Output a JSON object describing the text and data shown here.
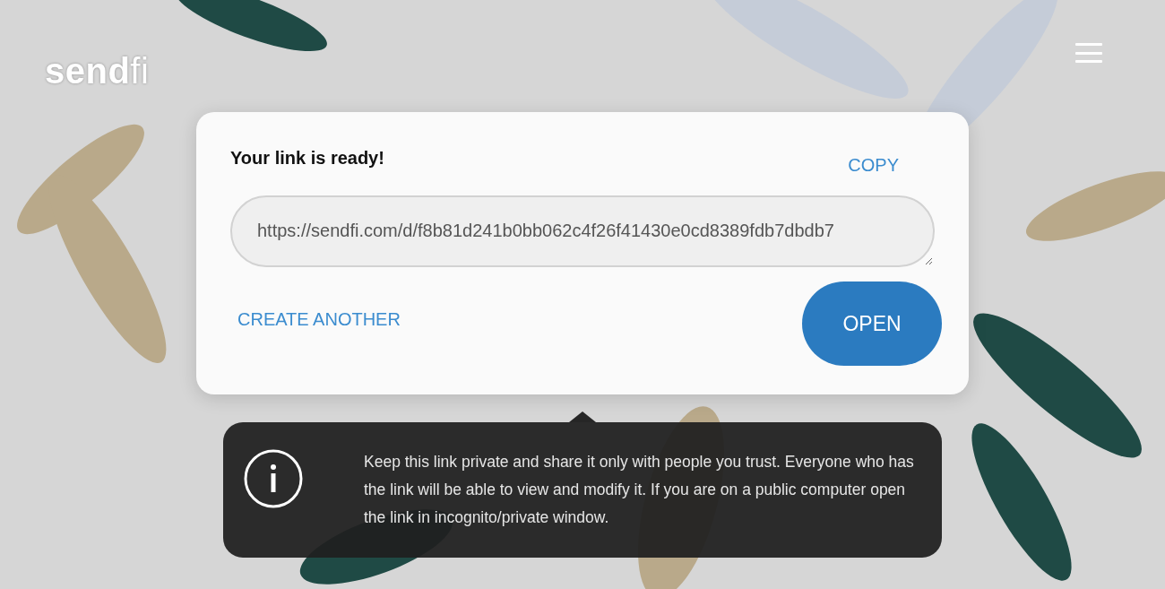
{
  "header": {
    "logo": "**send**fi"
  },
  "link_card": {
    "title": "Your link is ready!",
    "copy_button": "COPY",
    "link": "https://sendfi.com/d/f8b81d241b0bb062c4f26f41430e0cd8389fdb7dbdb7",
    "create_another_button": "CREATE ANOTHER",
    "open_button": "OPEN"
  },
  "notice": {
    "text": "Keep this link private and share it only with people you trust. Everyone who has the link will be able to view and modify it. If you are on a public computer open the link in incognito/private window."
  }
}
